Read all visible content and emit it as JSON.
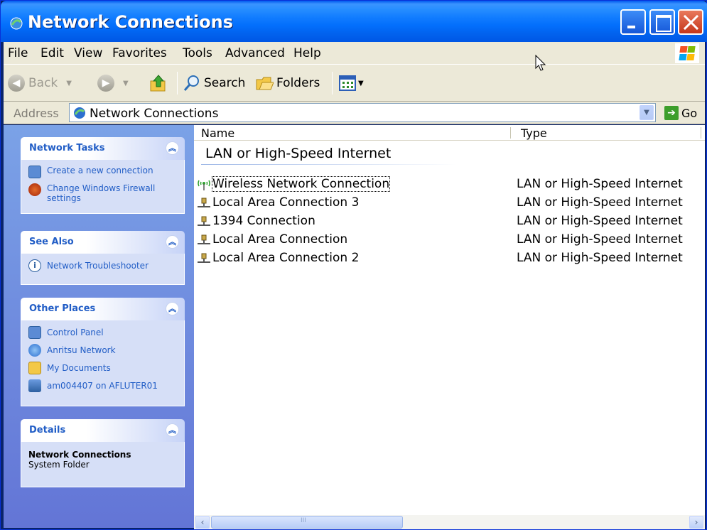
{
  "window": {
    "title": "Network Connections"
  },
  "menu": [
    "File",
    "Edit",
    "View",
    "Favorites",
    "Tools",
    "Advanced",
    "Help"
  ],
  "toolbar": {
    "back": "Back",
    "search": "Search",
    "folders": "Folders"
  },
  "address": {
    "label": "Address",
    "value": "Network Connections",
    "go": "Go"
  },
  "sidebar": {
    "network_tasks": {
      "title": "Network Tasks",
      "items": [
        "Create a new connection",
        "Change Windows Firewall settings"
      ]
    },
    "see_also": {
      "title": "See Also",
      "items": [
        "Network Troubleshooter"
      ]
    },
    "other_places": {
      "title": "Other Places",
      "items": [
        "Control Panel",
        "Anritsu Network",
        "My Documents",
        "am004407 on AFLUTER01"
      ]
    },
    "details": {
      "title": "Details",
      "name": "Network Connections",
      "kind": "System Folder"
    }
  },
  "content": {
    "columns": {
      "name": "Name",
      "type": "Type"
    },
    "group": "LAN or High-Speed Internet",
    "rows": [
      {
        "name": "Wireless Network Connection",
        "type": "LAN or High-Speed Internet",
        "icon": "wireless-icon"
      },
      {
        "name": "Local Area Connection 3",
        "type": "LAN or High-Speed Internet",
        "icon": "network-plug-icon"
      },
      {
        "name": "1394 Connection",
        "type": "LAN or High-Speed Internet",
        "icon": "network-plug-icon"
      },
      {
        "name": "Local Area Connection",
        "type": "LAN or High-Speed Internet",
        "icon": "network-plug-icon"
      },
      {
        "name": "Local Area Connection 2",
        "type": "LAN or High-Speed Internet",
        "icon": "network-plug-icon"
      }
    ]
  }
}
